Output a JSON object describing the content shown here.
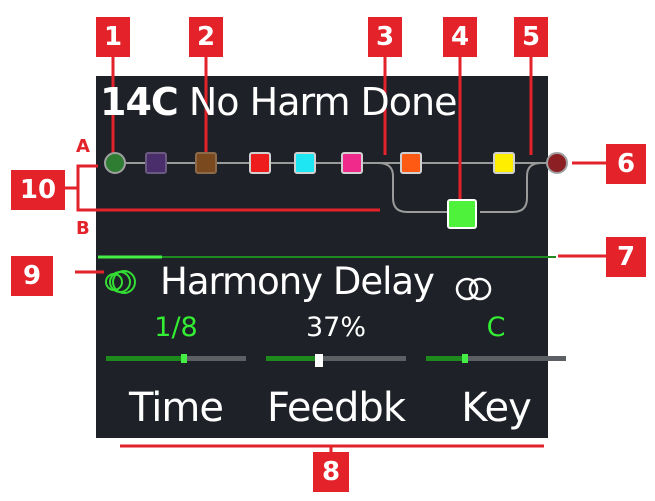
{
  "preset": {
    "number": "14C",
    "name": "No Harm Done"
  },
  "signal_chain": {
    "path_a_label": "A",
    "path_b_label": "B",
    "input_color": "#2e7d32",
    "output_color": "#8b1f24",
    "blocks_path_a": [
      "#4a2d6b",
      "#7a4a1e",
      "#ee1c1c",
      "#1ee6f2",
      "#ef2a8b",
      "#ff5a14",
      "#ffee00"
    ],
    "block_path_b": "#4ef23b"
  },
  "selected_block": {
    "name": "Harmony Delay",
    "icon_left": "harmony-delay-icon",
    "icon_right": "stereo-icon",
    "accent": "#33dd33"
  },
  "params": [
    {
      "value": "1/8",
      "label": "Time",
      "value_color": "#33ee33",
      "level": 0.55
    },
    {
      "value": "37%",
      "label": "Feedbk",
      "value_color": "#ffffff",
      "level": 0.37
    },
    {
      "value": "C",
      "label": "Key",
      "value_color": "#33ee33",
      "level": 0.27
    }
  ],
  "callouts": [
    "1",
    "2",
    "3",
    "4",
    "5",
    "6",
    "7",
    "8",
    "9",
    "10"
  ],
  "colors": {
    "callout": "#e3222a",
    "screen": "#1e2127"
  }
}
